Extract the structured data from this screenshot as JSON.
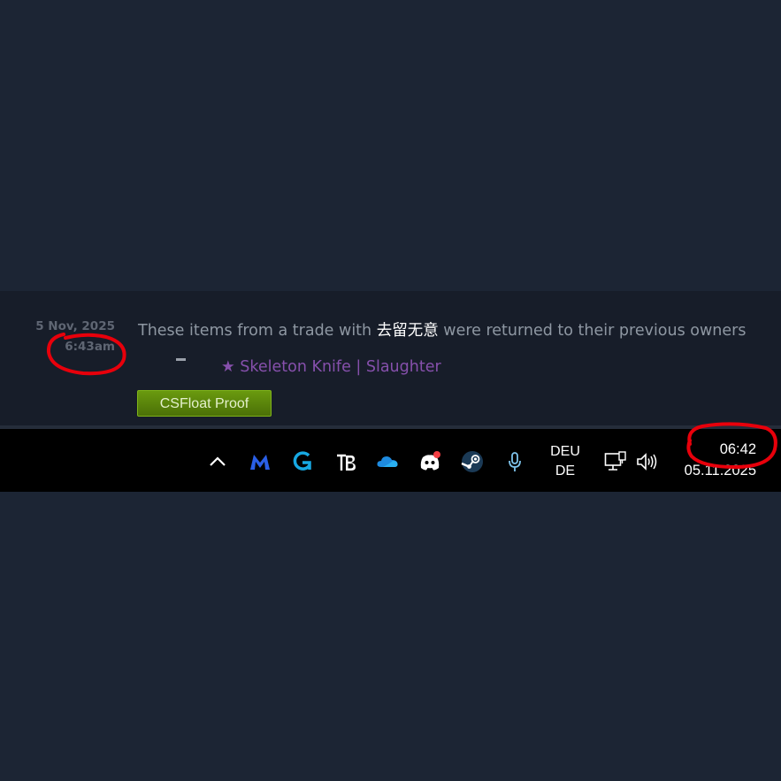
{
  "trade": {
    "date": "5 Nov, 2025",
    "time": "6:43am",
    "message_prefix": "These items from a trade with ",
    "partner_name": "去留无意",
    "message_suffix": " were returned to their previous owners",
    "item_name": "★ Skeleton Knife | Slaughter",
    "proof_button_label": "CSFloat Proof"
  },
  "taskbar": {
    "tray_icons": [
      "chevron-up-icon",
      "malwarebytes-icon",
      "logitech-g-icon",
      "tb-icon",
      "onedrive-icon",
      "discord-icon",
      "steam-icon",
      "microphone-icon",
      "network-icon",
      "volume-icon"
    ],
    "language_line1": "DEU",
    "language_line2": "DE",
    "clock_time": "06:42",
    "clock_date": "05.11.2025"
  },
  "colors": {
    "background": "#1c2534",
    "trade_row": "#171d29",
    "item_purple": "#8650ac",
    "button_green": "#5b850b",
    "annotation_red": "#e8000b"
  }
}
